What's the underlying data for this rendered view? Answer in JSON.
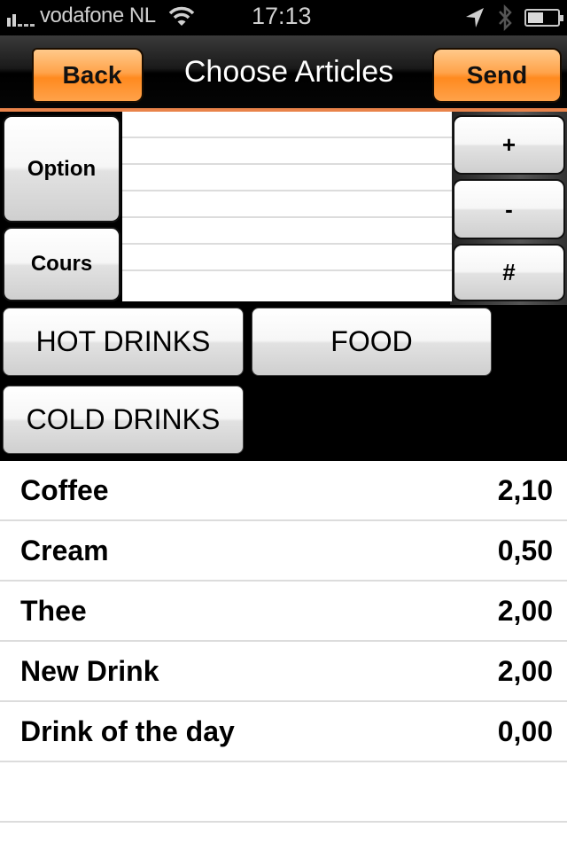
{
  "status_bar": {
    "carrier": "vodafone NL",
    "time": "17:13",
    "icons": [
      "signal-icon",
      "wifi-icon",
      "location-icon",
      "bluetooth-icon",
      "battery-icon"
    ]
  },
  "navbar": {
    "title": "Choose Articles",
    "back_label": "Back",
    "send_label": "Send",
    "accent_color": "#ff9a3a"
  },
  "controls": {
    "option_label": "Option",
    "cours_label": "Cours",
    "plus_label": "+",
    "minus_label": "-",
    "hash_label": "#"
  },
  "order_lines": [
    "",
    "",
    "",
    "",
    "",
    "",
    ""
  ],
  "categories": [
    {
      "label": "HOT DRINKS"
    },
    {
      "label": "FOOD"
    },
    {
      "label": "COLD DRINKS"
    }
  ],
  "articles": [
    {
      "name": "Coffee",
      "price": "2,10"
    },
    {
      "name": "Cream",
      "price": "0,50"
    },
    {
      "name": "Thee",
      "price": "2,00"
    },
    {
      "name": "New Drink",
      "price": "2,00"
    },
    {
      "name": "Drink of the day",
      "price": "0,00"
    }
  ]
}
